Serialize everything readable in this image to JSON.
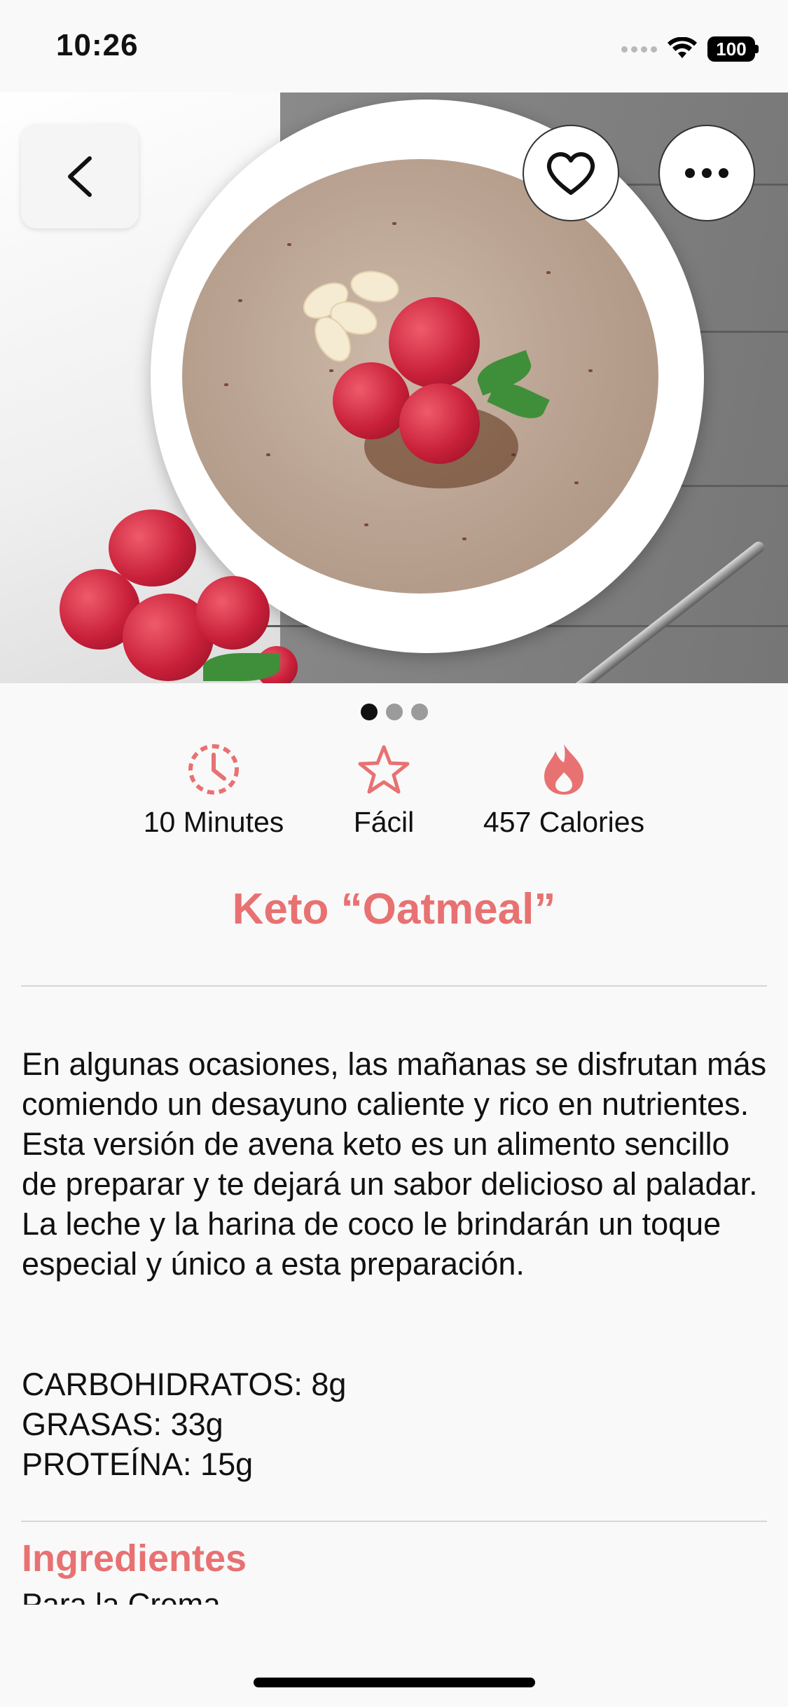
{
  "status_bar": {
    "time": "10:26",
    "battery": "100"
  },
  "hero": {
    "image_description": "",
    "page_count": 3,
    "active_page": 1
  },
  "stats": {
    "time_label": "10 Minutes",
    "difficulty_label": "Fácil",
    "calories_label": "457 Calories"
  },
  "recipe": {
    "title": "Keto  “Oatmeal”",
    "description": "En algunas ocasiones, las mañanas se disfrutan más comiendo un desayuno caliente y rico en nutrientes. Esta versión de avena keto es un alimento sencillo de preparar y te dejará un sabor delicioso al paladar. La leche y la harina de coco le brindarán un toque especial y único a esta preparación.",
    "macros": [
      "CARBOHIDRATOS: 8g",
      "GRASAS: 33g",
      "PROTEÍNA: 15g"
    ],
    "ingredients_title": "Ingredientes",
    "ingredients_subtitle": "Para la Crema"
  },
  "colors": {
    "accent": "#e87172",
    "background": "#f9f9f9"
  }
}
